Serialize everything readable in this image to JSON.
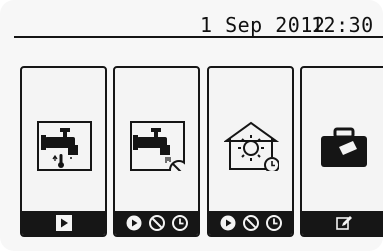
{
  "status_bar": {
    "date": "1 Sep 2012",
    "time": "12:30"
  },
  "menu": [
    {
      "id": "hot-water",
      "icon": "hot-water-tap-icon",
      "footer_icons": [
        "play-icon"
      ]
    },
    {
      "id": "hot-water-off",
      "icon": "hot-water-tap-off-icon",
      "footer_icons": [
        "on-icon",
        "prohibited-icon",
        "timer-icon"
      ]
    },
    {
      "id": "heating",
      "icon": "house-sun-icon",
      "footer_icons": [
        "on-icon",
        "prohibited-icon",
        "timer-icon"
      ]
    },
    {
      "id": "holiday",
      "icon": "suitcase-icon",
      "footer_icons": [
        "edit-icon"
      ]
    }
  ]
}
